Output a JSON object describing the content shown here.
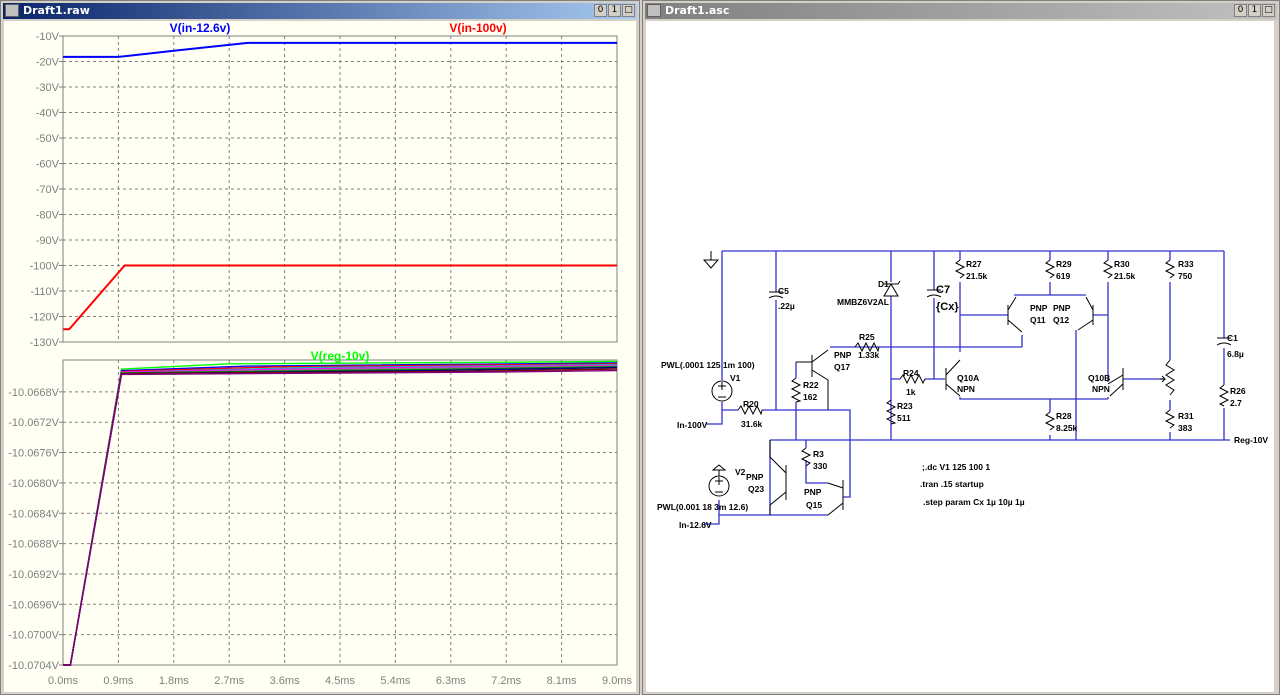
{
  "waveform_window": {
    "title": "Draft1.raw",
    "buttons": [
      "0",
      "1",
      "□"
    ]
  },
  "schematic_window": {
    "title": "Draft1.asc",
    "buttons": [
      "0",
      "1",
      "□"
    ]
  },
  "chart_data": [
    {
      "type": "line",
      "xlim": [
        0,
        9
      ],
      "ylim": [
        -130,
        -10
      ],
      "x_ticks": [
        "0.0ms",
        "0.9ms",
        "1.8ms",
        "2.7ms",
        "3.6ms",
        "4.5ms",
        "5.4ms",
        "6.3ms",
        "7.2ms",
        "8.1ms",
        "9.0ms"
      ],
      "y_ticks": [
        "-10V",
        "-20V",
        "-30V",
        "-40V",
        "-50V",
        "-60V",
        "-70V",
        "-80V",
        "-90V",
        "-100V",
        "-110V",
        "-120V",
        "-130V"
      ],
      "grid": true,
      "series": [
        {
          "name": "V(in-12.6v)",
          "color": "#0000ff",
          "points": [
            [
              0,
              -18.2
            ],
            [
              0.9,
              -18.2
            ],
            [
              1.8,
              -15.8
            ],
            [
              3.0,
              -12.7
            ],
            [
              9,
              -12.7
            ]
          ]
        },
        {
          "name": "V(in-100v)",
          "color": "#ff0000",
          "points": [
            [
              0,
              -125
            ],
            [
              0.1,
              -125
            ],
            [
              1.0,
              -100
            ],
            [
              9,
              -100
            ]
          ]
        }
      ]
    },
    {
      "type": "line",
      "xlim": [
        0,
        9
      ],
      "ylim": [
        -10.0704,
        -10.06638
      ],
      "x_ticks": [
        "0.0ms",
        "0.9ms",
        "1.8ms",
        "2.7ms",
        "3.6ms",
        "4.5ms",
        "5.4ms",
        "6.3ms",
        "7.2ms",
        "8.1ms",
        "9.0ms"
      ],
      "y_ticks": [
        "-10.0668V",
        "-10.0672V",
        "-10.0676V",
        "-10.0680V",
        "-10.0684V",
        "-10.0688V",
        "-10.0692V",
        "-10.0696V",
        "-10.0700V",
        "-10.0704V"
      ],
      "grid": true,
      "series": [
        {
          "name": "V(reg-10v)",
          "color": "#00ff00",
          "points": [
            [
              0,
              -10.0704
            ],
            [
              0.12,
              -10.0704
            ],
            [
              0.95,
              -10.0665
            ],
            [
              2.7,
              -10.06643
            ],
            [
              9,
              -10.0664
            ]
          ]
        },
        {
          "color": "#0000ff",
          "points": [
            [
              0,
              -10.0704
            ],
            [
              0.12,
              -10.0704
            ],
            [
              0.95,
              -10.06652
            ],
            [
              3,
              -10.06646
            ],
            [
              9,
              -10.06642
            ]
          ]
        },
        {
          "color": "#ff0000",
          "points": [
            [
              0,
              -10.0704
            ],
            [
              0.12,
              -10.0704
            ],
            [
              0.95,
              -10.06653
            ],
            [
              3.5,
              -10.06647
            ],
            [
              9,
              -10.06643
            ]
          ]
        },
        {
          "color": "#00c0c0",
          "points": [
            [
              0,
              -10.0704
            ],
            [
              0.12,
              -10.0704
            ],
            [
              0.95,
              -10.06654
            ],
            [
              4,
              -10.06648
            ],
            [
              9,
              -10.06644
            ]
          ]
        },
        {
          "color": "#ff00ff",
          "points": [
            [
              0,
              -10.0704
            ],
            [
              0.12,
              -10.0704
            ],
            [
              0.95,
              -10.06654
            ],
            [
              4.5,
              -10.06649
            ],
            [
              9,
              -10.06645
            ]
          ]
        },
        {
          "color": "#808080",
          "points": [
            [
              0,
              -10.0704
            ],
            [
              0.12,
              -10.0704
            ],
            [
              0.95,
              -10.06655
            ],
            [
              5,
              -10.0665
            ],
            [
              9,
              -10.06646
            ]
          ]
        },
        {
          "color": "#008000",
          "points": [
            [
              0,
              -10.0704
            ],
            [
              0.12,
              -10.0704
            ],
            [
              0.95,
              -10.06655
            ],
            [
              5.5,
              -10.06651
            ],
            [
              9,
              -10.06647
            ]
          ]
        },
        {
          "color": "#000080",
          "points": [
            [
              0,
              -10.0704
            ],
            [
              0.12,
              -10.0704
            ],
            [
              0.95,
              -10.06656
            ],
            [
              6,
              -10.06652
            ],
            [
              9,
              -10.06648
            ]
          ]
        },
        {
          "color": "#800000",
          "points": [
            [
              0,
              -10.0704
            ],
            [
              0.12,
              -10.0704
            ],
            [
              0.95,
              -10.06656
            ],
            [
              6.5,
              -10.06653
            ],
            [
              9,
              -10.0665
            ]
          ]
        },
        {
          "color": "#800080",
          "points": [
            [
              0,
              -10.0704
            ],
            [
              0.12,
              -10.0704
            ],
            [
              0.95,
              -10.06657
            ],
            [
              7,
              -10.06654
            ],
            [
              9,
              -10.06652
            ]
          ]
        }
      ]
    }
  ],
  "schematic": {
    "labels": {
      "c5": "C5",
      "c5v": ".22µ",
      "d1": "D1",
      "d1v": "MMBZ6V2AL",
      "c7": "C7",
      "c7v": "{Cx}",
      "r27": "R27",
      "r27v": "21.5k",
      "r29": "R29",
      "r29v": "619",
      "r30": "R30",
      "r30v": "21.5k",
      "r33": "R33",
      "r33v": "750",
      "r25": "R25",
      "r25v": "1.33k",
      "q17t": "PNP",
      "q17": "Q17",
      "q11t": "PNP",
      "q11": "Q11",
      "q12t": "PNP",
      "q12": "Q12",
      "v1w": "PWL(.0001 125 1m 100)",
      "v1": "V1",
      "r22": "R22",
      "r22v": "162",
      "r24": "R24",
      "r24v": "1k",
      "q10a": "Q10A",
      "q10at": "NPN",
      "q10b": "Q10B",
      "q10bt": "NPN",
      "c1": "C1",
      "c1v": "6.8µ",
      "r26": "R26",
      "r26v": "2.7",
      "r20": "R20",
      "r20v": "31.6k",
      "in100": "In-100V",
      "r23": "R23",
      "r23v": "511",
      "r28": "R28",
      "r28v": "8.25k",
      "r31": "R31",
      "r31v": "383",
      "reg": "Reg-10V",
      "r3": "R3",
      "r3v": "330",
      "v2": "V2",
      "q23t": "PNP",
      "q23": "Q23",
      "q15t": "PNP",
      "q15": "Q15",
      "v2w": "PWL(0.001 18 3m 12.6)",
      "in126": "In-12.6V"
    },
    "directives": [
      ";.dc V1 125 100 1",
      ".tran .15 startup",
      ".step param Cx 1µ 10µ 1µ"
    ],
    "wire_color": "#3333cc"
  }
}
